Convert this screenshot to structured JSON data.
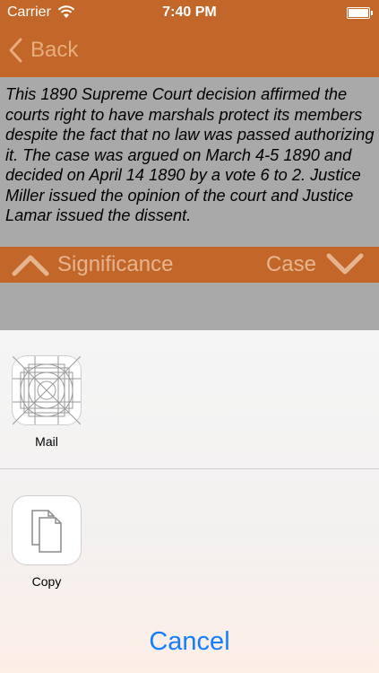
{
  "status": {
    "carrier": "Carrier",
    "time": "7:40 PM"
  },
  "nav": {
    "back_label": "Back"
  },
  "description": "This 1890 Supreme Court decision affirmed the courts right to have marshals protect its members despite the fact that no law was passed authorizing it. The case was argued on March 4-5 1890 and decided on April 14 1890 by a vote 6 to 2.  Justice Miller issued the opinion of the court and Justice Lamar issued the dissent.",
  "bar": {
    "left_label": "Significance",
    "right_label": "Case"
  },
  "share": {
    "actions": [
      {
        "label": "Mail"
      },
      {
        "label": "Copy"
      }
    ],
    "cancel_label": "Cancel"
  },
  "colors": {
    "nav_orange": "#c2662a",
    "ios_blue": "#157efb"
  }
}
